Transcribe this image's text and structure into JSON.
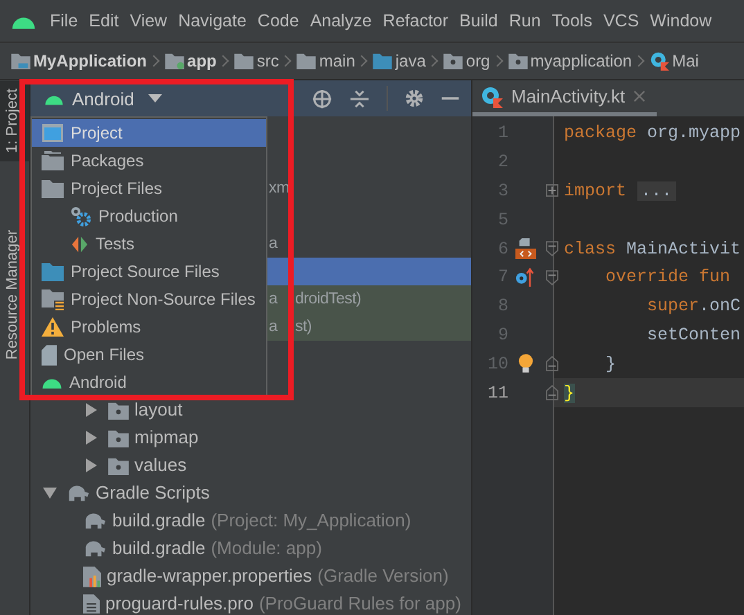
{
  "menu": [
    "File",
    "Edit",
    "View",
    "Navigate",
    "Code",
    "Analyze",
    "Refactor",
    "Build",
    "Run",
    "Tools",
    "VCS",
    "Window"
  ],
  "breadcrumbs": [
    {
      "label": "MyApplication",
      "kind": "project",
      "bold": true
    },
    {
      "label": "app",
      "kind": "module",
      "bold": true
    },
    {
      "label": "src",
      "kind": "folder",
      "bold": false
    },
    {
      "label": "main",
      "kind": "folder",
      "bold": false
    },
    {
      "label": "java",
      "kind": "source",
      "bold": false
    },
    {
      "label": "org",
      "kind": "package",
      "bold": false
    },
    {
      "label": "myapplication",
      "kind": "package",
      "bold": false
    },
    {
      "label": "Mai",
      "kind": "kotlin",
      "bold": false
    }
  ],
  "side_strip": {
    "tabs": [
      {
        "label": "1: Project",
        "selected": true
      },
      {
        "label": "Resource Manager",
        "selected": false
      }
    ]
  },
  "project_panel": {
    "view_selector": "Android",
    "popup": [
      {
        "label": "Project",
        "kind": "project",
        "selected": true,
        "nested": false
      },
      {
        "label": "Packages",
        "kind": "packages",
        "selected": false,
        "nested": false
      },
      {
        "label": "Project Files",
        "kind": "folder",
        "selected": false,
        "nested": false
      },
      {
        "label": "Production",
        "kind": "production",
        "selected": false,
        "nested": true
      },
      {
        "label": "Tests",
        "kind": "tests",
        "selected": false,
        "nested": true
      },
      {
        "label": "Project Source Files",
        "kind": "source",
        "selected": false,
        "nested": false
      },
      {
        "label": "Project Non-Source Files",
        "kind": "nonsource",
        "selected": false,
        "nested": false
      },
      {
        "label": "Problems",
        "kind": "problems",
        "selected": false,
        "nested": false
      },
      {
        "label": "Open Files",
        "kind": "openfiles",
        "selected": false,
        "nested": false
      },
      {
        "label": "Android",
        "kind": "android",
        "selected": false,
        "nested": false
      }
    ],
    "hidden_rows": [
      {
        "selected": false,
        "kind": "plain"
      },
      {
        "selected": false,
        "kind": "plain"
      },
      {
        "left_text": "xm",
        "selected": false,
        "kind": "plain"
      },
      {
        "selected": false,
        "kind": "plain"
      },
      {
        "left_text": "a",
        "selected": false,
        "kind": "plain"
      },
      {
        "selected": true,
        "kind": "plain"
      },
      {
        "left_text": "a",
        "right_text": "droidTest)",
        "selected": false,
        "kind": "test"
      },
      {
        "left_text": "a",
        "right_text": "st)",
        "selected": false,
        "kind": "test"
      },
      {
        "selected": false,
        "kind": "plain"
      },
      {
        "selected": false,
        "kind": "plain"
      }
    ],
    "res_folders": [
      {
        "label": "layout",
        "expanded": false
      },
      {
        "label": "mipmap",
        "expanded": false
      },
      {
        "label": "values",
        "expanded": false
      }
    ],
    "tree": [
      {
        "label": "Gradle Scripts",
        "kind": "gradle",
        "expanded": true,
        "children": [
          {
            "label": "build.gradle",
            "note": "(Project: My_Application)",
            "kind": "gradle"
          },
          {
            "label": "build.gradle",
            "note": "(Module: app)",
            "kind": "gradle"
          },
          {
            "label": "gradle-wrapper.properties",
            "note": "(Gradle Version)",
            "kind": "properties"
          },
          {
            "label": "proguard-rules.pro",
            "note": "(ProGuard Rules for app)",
            "kind": "text"
          }
        ]
      }
    ]
  },
  "editor": {
    "tab": "MainActivity.kt",
    "lines": [
      {
        "number": "1",
        "current": false,
        "tokens": [
          {
            "text": "package ",
            "kind": "keyword"
          },
          {
            "text": "org.myapp",
            "kind": "plain"
          }
        ]
      },
      {
        "number": "2",
        "current": false
      },
      {
        "number": "3",
        "current": false,
        "fold": {
          "kind": "plus"
        },
        "tokens": [
          {
            "text": "import ",
            "kind": "keyword"
          },
          {
            "text": "...",
            "kind": "folded"
          }
        ]
      },
      {
        "number": "5",
        "current": false
      },
      {
        "number": "6",
        "current": false,
        "gutter": {
          "kind": "layout"
        },
        "fold": {
          "kind": "minus"
        },
        "tokens": [
          {
            "text": "class ",
            "kind": "keyword"
          },
          {
            "text": "MainActivit",
            "kind": "plain"
          }
        ]
      },
      {
        "number": "7",
        "current": false,
        "gutter": {
          "kind": "override"
        },
        "fold": {
          "kind": "minus"
        },
        "tokens": [
          {
            "text": "    override fun",
            "kind": "keyword"
          }
        ]
      },
      {
        "number": "8",
        "current": false,
        "tokens": [
          {
            "text": "        super",
            "kind": "keyword"
          },
          {
            "text": ".onC",
            "kind": "plain"
          }
        ]
      },
      {
        "number": "9",
        "current": false,
        "tokens": [
          {
            "text": "        setConten",
            "kind": "plain"
          }
        ]
      },
      {
        "number": "10",
        "current": false,
        "gutter": {
          "kind": "bulb"
        },
        "fold": {
          "kind": "end"
        },
        "tokens": [
          {
            "text": "    }",
            "kind": "plain"
          }
        ]
      },
      {
        "number": "11",
        "current": true,
        "fold": {
          "kind": "end"
        },
        "tokens": [
          {
            "text": "}",
            "kind": "brace"
          }
        ]
      }
    ]
  }
}
